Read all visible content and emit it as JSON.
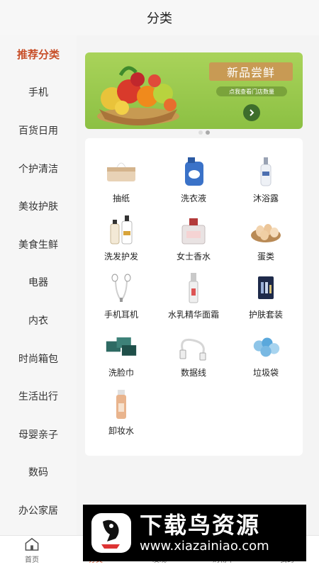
{
  "header": {
    "title": "分类"
  },
  "sidebar": {
    "items": [
      {
        "label": "推荐分类",
        "active": true
      },
      {
        "label": "手机"
      },
      {
        "label": "百货日用"
      },
      {
        "label": "个护清洁"
      },
      {
        "label": "美妆护肤"
      },
      {
        "label": "美食生鲜"
      },
      {
        "label": "电器"
      },
      {
        "label": "内衣"
      },
      {
        "label": "时尚箱包"
      },
      {
        "label": "生活出行"
      },
      {
        "label": "母婴亲子"
      },
      {
        "label": "数码"
      },
      {
        "label": "办公家居"
      }
    ]
  },
  "banner": {
    "slogan": "新品尝鲜",
    "subtext": "点我查看门店数量",
    "arrow_icon": "arrow-right-icon"
  },
  "categories": [
    {
      "label": "抽纸",
      "icon": "tissue-box-icon"
    },
    {
      "label": "洗衣液",
      "icon": "laundry-detergent-icon"
    },
    {
      "label": "沐浴露",
      "icon": "shower-gel-icon"
    },
    {
      "label": "洗发护发",
      "icon": "shampoo-icon"
    },
    {
      "label": "女士香水",
      "icon": "perfume-icon"
    },
    {
      "label": "蛋类",
      "icon": "eggs-icon"
    },
    {
      "label": "手机耳机",
      "icon": "earphones-icon"
    },
    {
      "label": "水乳精华面霜",
      "icon": "lotion-icon"
    },
    {
      "label": "护肤套装",
      "icon": "skincare-set-icon"
    },
    {
      "label": "洗脸巾",
      "icon": "face-towel-icon"
    },
    {
      "label": "数据线",
      "icon": "usb-cable-icon"
    },
    {
      "label": "垃圾袋",
      "icon": "trash-bag-icon"
    },
    {
      "label": "卸妆水",
      "icon": "makeup-remover-icon"
    }
  ],
  "tabbar": {
    "items": [
      {
        "label": "首页",
        "icon": "home-icon"
      },
      {
        "label": "分类",
        "icon": "category-icon",
        "active": true
      },
      {
        "label": "发现",
        "icon": "discover-icon"
      },
      {
        "label": "购物车",
        "icon": "cart-icon"
      },
      {
        "label": "我的",
        "icon": "profile-icon"
      }
    ]
  },
  "watermark": {
    "title": "下载鸟资源",
    "url": "www.xiazainiao.com"
  },
  "colors": {
    "accent": "#c8502a",
    "banner_green": "#8cc043",
    "sidebar_bg": "#f6f6f6"
  }
}
